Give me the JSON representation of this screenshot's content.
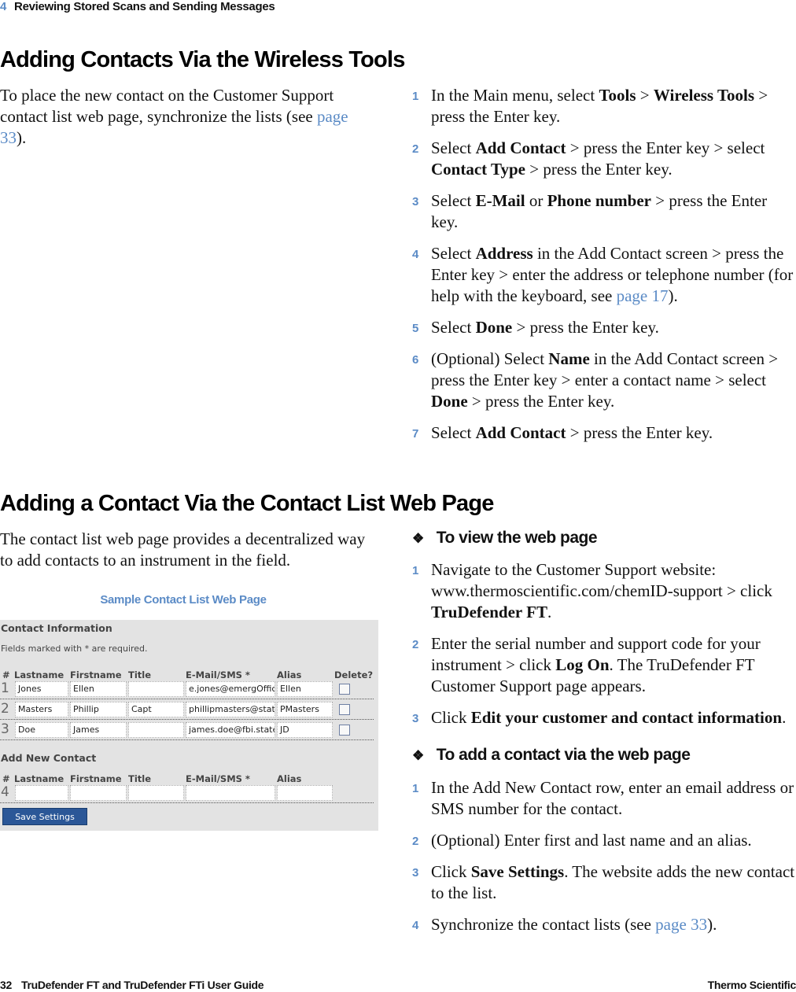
{
  "running_head": {
    "chapter": "4",
    "title": "Reviewing Stored Scans and Sending Messages"
  },
  "section1": {
    "heading": "Adding Contacts Via the Wireless Tools",
    "intro": {
      "text": "To place the new contact on the Customer Support contact list web page, synchronize the lists (see ",
      "link": "page 33",
      "after": ")."
    },
    "steps": [
      {
        "num": "1",
        "parts": [
          [
            "In the Main menu, select ",
            false
          ],
          [
            "Tools",
            true
          ],
          [
            " > ",
            false
          ],
          [
            "Wireless Tools",
            true
          ],
          [
            " > press the Enter key.",
            false
          ]
        ]
      },
      {
        "num": "2",
        "parts": [
          [
            "Select ",
            false
          ],
          [
            "Add Contact",
            true
          ],
          [
            " > press the Enter key > select ",
            false
          ],
          [
            "Contact Type",
            true
          ],
          [
            " > press the Enter key.",
            false
          ]
        ]
      },
      {
        "num": "3",
        "parts": [
          [
            "Select ",
            false
          ],
          [
            "E-Mail",
            true
          ],
          [
            " or ",
            false
          ],
          [
            "Phone number",
            true
          ],
          [
            " > press the Enter key.",
            false
          ]
        ]
      },
      {
        "num": "4",
        "parts": [
          [
            "Select ",
            false
          ],
          [
            "Address",
            true
          ],
          [
            " in the Add Contact screen > press the Enter key > enter the address or telephone number (for help with the keyboard, see ",
            false
          ],
          [
            "page 17",
            "link"
          ],
          [
            ").",
            false
          ]
        ]
      },
      {
        "num": "5",
        "parts": [
          [
            "Select ",
            false
          ],
          [
            "Done",
            true
          ],
          [
            " > press the Enter key.",
            false
          ]
        ]
      },
      {
        "num": "6",
        "parts": [
          [
            "(Optional) Select ",
            false
          ],
          [
            "Name",
            true
          ],
          [
            " in the Add Contact screen > press the Enter key > enter a contact name > select ",
            false
          ],
          [
            "Done",
            true
          ],
          [
            " > press the Enter key.",
            false
          ]
        ]
      },
      {
        "num": "7",
        "parts": [
          [
            "Select ",
            false
          ],
          [
            "Add Contact",
            true
          ],
          [
            " > press the Enter key.",
            false
          ]
        ]
      }
    ]
  },
  "section2": {
    "heading": "Adding a Contact Via the Contact List Web Page",
    "intro": "The contact list web page provides a decentralized way to add contacts to an instrument in the field.",
    "figure_caption": "Sample Contact List Web Page",
    "procedure1": {
      "title": "To view the web page",
      "steps": [
        {
          "num": "1",
          "parts": [
            [
              "Navigate to the Customer Support website: www.thermoscientific.com/chemID-support > click ",
              false
            ],
            [
              "TruDefender FT",
              true
            ],
            [
              ".",
              false
            ]
          ]
        },
        {
          "num": "2",
          "parts": [
            [
              "Enter the serial number and support code for your instrument > click ",
              false
            ],
            [
              "Log On",
              true
            ],
            [
              ". The TruDefender FT Customer Support page appears.",
              false
            ]
          ]
        },
        {
          "num": "3",
          "parts": [
            [
              "Click ",
              false
            ],
            [
              "Edit your customer and contact information",
              true
            ],
            [
              ".",
              false
            ]
          ]
        }
      ]
    },
    "procedure2": {
      "title": "To add a contact via the web page",
      "steps": [
        {
          "num": "1",
          "parts": [
            [
              "In the Add New Contact row, enter an email address or SMS number for the contact.",
              false
            ]
          ]
        },
        {
          "num": "2",
          "parts": [
            [
              "(Optional) Enter first and last name and an alias.",
              false
            ]
          ]
        },
        {
          "num": "3",
          "parts": [
            [
              "Click ",
              false
            ],
            [
              "Save Settings",
              true
            ],
            [
              ". The website adds the new contact to the list.",
              false
            ]
          ]
        },
        {
          "num": "4",
          "parts": [
            [
              "Synchronize the contact lists (see ",
              false
            ],
            [
              "page 33",
              "link"
            ],
            [
              ").",
              false
            ]
          ]
        }
      ]
    }
  },
  "web_form": {
    "title": "Contact Information",
    "note": "Fields marked with * are required.",
    "headers": [
      "#",
      "Lastname",
      "Firstname",
      "Title",
      "E-Mail/SMS *",
      "Alias",
      "Delete?"
    ],
    "rows": [
      {
        "num": "1",
        "lastname": "Jones",
        "firstname": "Ellen",
        "title": "",
        "email": "e.jones@emergOffic",
        "alias": "Ellen",
        "delete": false
      },
      {
        "num": "2",
        "lastname": "Masters",
        "firstname": "Phillip",
        "title": "Capt",
        "email": "phillipmasters@state",
        "alias": "PMasters",
        "delete": false
      },
      {
        "num": "3",
        "lastname": "Doe",
        "firstname": "James",
        "title": "",
        "email": "james.doe@fbi.state",
        "alias": "JD",
        "delete": false
      }
    ],
    "add_title": "Add New Contact",
    "add_headers": [
      "#",
      "Lastname",
      "Firstname",
      "Title",
      "E-Mail/SMS *",
      "Alias"
    ],
    "add_row": {
      "num": "4",
      "lastname": "",
      "firstname": "",
      "title": "",
      "email": "",
      "alias": ""
    },
    "save_button": "Save Settings"
  },
  "footer": {
    "page": "32",
    "guide": "TruDefender FT and TruDefender FTi User Guide",
    "brand": "Thermo Scientific"
  },
  "colors": {
    "accent": "#5b8bc6",
    "button": "#2b5797",
    "panel_bg": "#e3e3e3"
  }
}
